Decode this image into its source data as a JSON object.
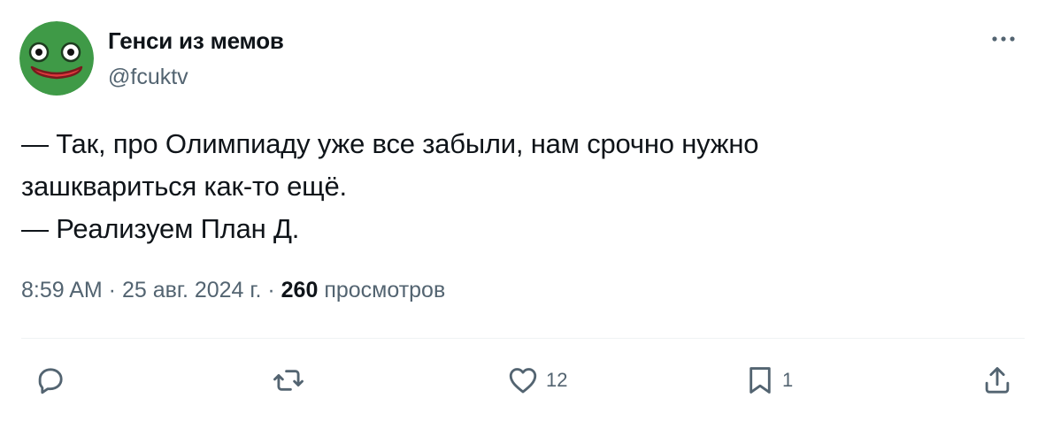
{
  "author": {
    "display_name": "Генси из мемов",
    "handle": "@fcuktv",
    "avatar_icon": "frog-face-avatar"
  },
  "more_icon": "ellipsis-icon",
  "tweet": {
    "lines": [
      "— Так, про Олимпиаду уже все забыли, нам срочно нужно",
      "зашквариться как-то ещё.",
      "— Реализуем План Д."
    ]
  },
  "meta": {
    "time": "8:59 AM",
    "separator1": " · ",
    "date": "25 авг. 2024 г.",
    "separator2": " · ",
    "views_count": "260",
    "views_label": " просмотров"
  },
  "actions": {
    "reply": {
      "icon": "reply-icon",
      "count": ""
    },
    "retweet": {
      "icon": "retweet-icon",
      "count": ""
    },
    "like": {
      "icon": "heart-icon",
      "count": "12"
    },
    "bookmark": {
      "icon": "bookmark-icon",
      "count": "1"
    },
    "share": {
      "icon": "share-icon",
      "count": ""
    }
  },
  "colors": {
    "text_primary": "#0f1419",
    "text_secondary": "#536471",
    "divider": "#eff3f4",
    "avatar_green": "#3f9a47",
    "avatar_mouth": "#e0393e"
  }
}
